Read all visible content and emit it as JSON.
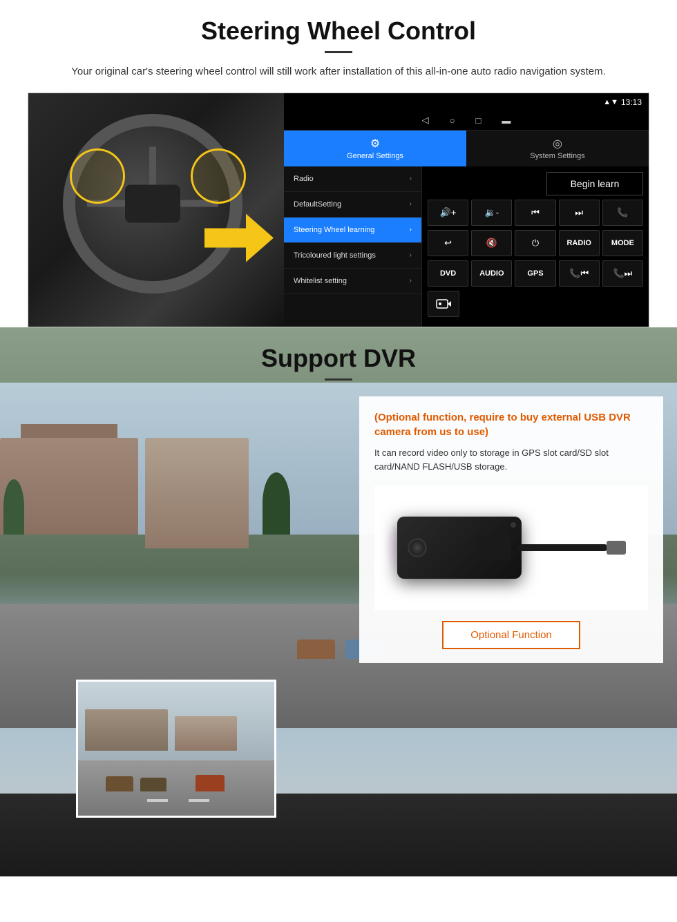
{
  "page": {
    "section1": {
      "title": "Steering Wheel Control",
      "description": "Your original car's steering wheel control will still work after installation of this all-in-one auto radio navigation system.",
      "ui": {
        "statusBar": {
          "time": "13:13",
          "signal": "▼",
          "wifi": "▲"
        },
        "tabs": {
          "general": {
            "label": "General Settings",
            "icon": "⚙"
          },
          "system": {
            "label": "System Settings",
            "icon": "◎"
          }
        },
        "menuItems": [
          {
            "label": "Radio",
            "active": false
          },
          {
            "label": "DefaultSetting",
            "active": false
          },
          {
            "label": "Steering Wheel learning",
            "active": true
          },
          {
            "label": "Tricoloured light settings",
            "active": false
          },
          {
            "label": "Whitelist setting",
            "active": false
          }
        ],
        "beginLearnBtn": "Begin learn",
        "controlButtons": [
          [
            "vol+",
            "vol-",
            "prev",
            "next",
            "phone"
          ],
          [
            "back",
            "mute",
            "power",
            "RADIO",
            "MODE"
          ],
          [
            "DVD",
            "AUDIO",
            "GPS",
            "tel+prev",
            "tel+next"
          ],
          [
            "dvr"
          ]
        ]
      }
    },
    "section2": {
      "title": "Support DVR",
      "card": {
        "optionalText": "(Optional function, require to buy external USB DVR camera from us to use)",
        "description": "It can record video only to storage in GPS slot card/SD slot card/NAND FLASH/USB storage."
      },
      "optionalFunctionBtn": "Optional Function"
    }
  }
}
